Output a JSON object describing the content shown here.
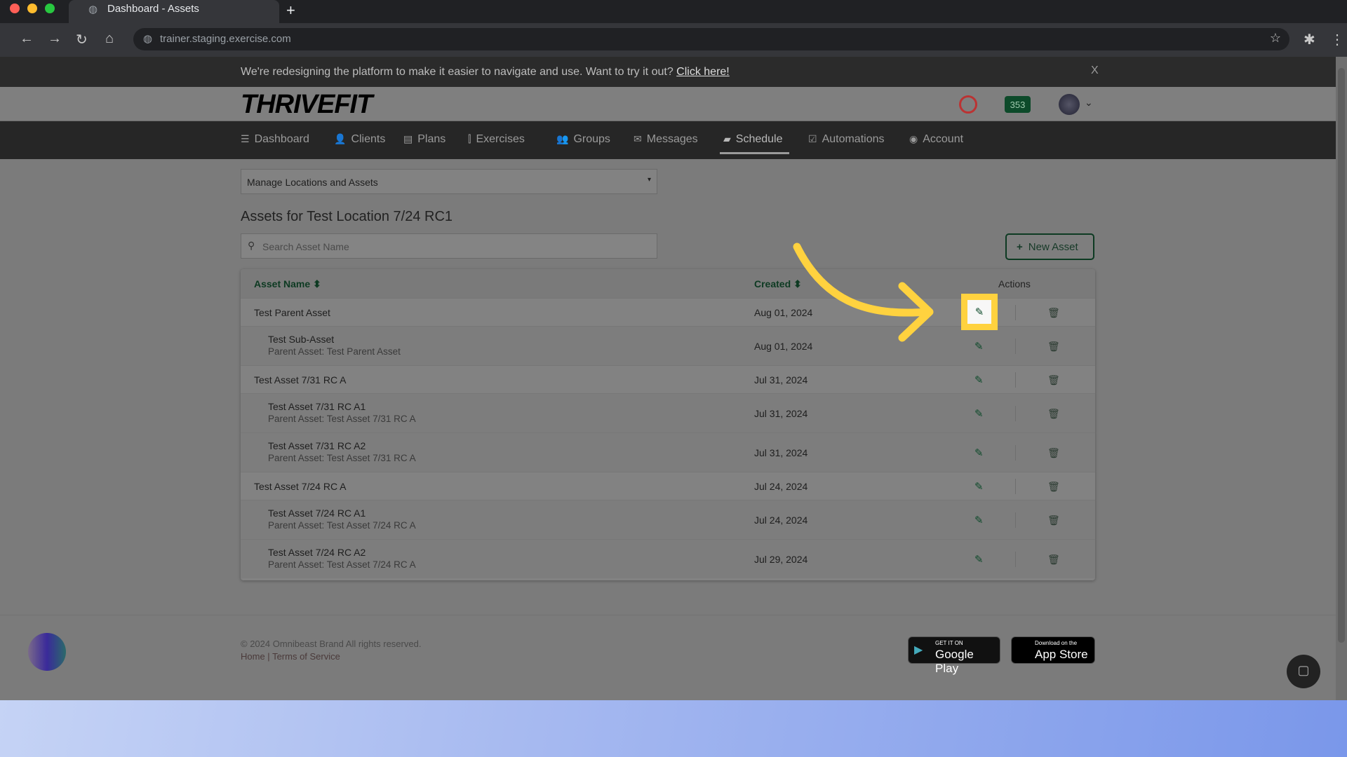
{
  "browser": {
    "tab_title": "Dashboard - Assets",
    "url": "trainer.staging.exercise.com"
  },
  "banner": {
    "text": "We're redesigning the platform to make it easier to navigate and use. Want to try it out?",
    "link": "Click here!",
    "close": "X"
  },
  "header": {
    "logo": "THRIVEFIT",
    "badge_count": "353"
  },
  "nav": [
    {
      "label": "Dashboard",
      "icon": "☰"
    },
    {
      "label": "Clients",
      "icon": "👤"
    },
    {
      "label": "Plans",
      "icon": "▤"
    },
    {
      "label": "Exercises",
      "icon": "⫿"
    },
    {
      "label": "Groups",
      "icon": "👥"
    },
    {
      "label": "Messages",
      "icon": "✉"
    },
    {
      "label": "Schedule",
      "icon": "▰",
      "active": true
    },
    {
      "label": "Automations",
      "icon": "☑"
    },
    {
      "label": "Account",
      "icon": "◉"
    }
  ],
  "main": {
    "select_value": "Manage Locations and Assets",
    "title": "Assets for Test Location 7/24 RC1",
    "search_placeholder": "Search Asset Name",
    "new_asset_label": "New Asset",
    "columns": {
      "name": "Asset Name",
      "created": "Created",
      "actions": "Actions"
    },
    "rows": [
      {
        "name": "Test Parent Asset",
        "parent": "",
        "created": "Aug 01, 2024",
        "highlight": true
      },
      {
        "name": "Test Sub-Asset",
        "parent": "Parent Asset: Test Parent Asset",
        "created": "Aug 01, 2024"
      },
      {
        "name": "Test Asset 7/31 RC A",
        "parent": "",
        "created": "Jul 31, 2024"
      },
      {
        "name": "Test Asset 7/31 RC A1",
        "parent": "Parent Asset: Test Asset 7/31 RC A",
        "created": "Jul 31, 2024"
      },
      {
        "name": "Test Asset 7/31 RC A2",
        "parent": "Parent Asset: Test Asset 7/31 RC A",
        "created": "Jul 31, 2024"
      },
      {
        "name": "Test Asset 7/24 RC A",
        "parent": "",
        "created": "Jul 24, 2024"
      },
      {
        "name": "Test Asset 7/24 RC A1",
        "parent": "Parent Asset: Test Asset 7/24 RC A",
        "created": "Jul 24, 2024"
      },
      {
        "name": "Test Asset 7/24 RC A2",
        "parent": "Parent Asset: Test Asset 7/24 RC A",
        "created": "Jul 29, 2024"
      }
    ]
  },
  "footer": {
    "copyright": "© 2024 Omnibeast Brand All rights reserved.",
    "home": "Home",
    "terms": "Terms of Service",
    "google_small": "GET IT ON",
    "google": "Google Play",
    "apple_small": "Download on the",
    "apple": "App Store"
  },
  "colors": {
    "accent": "#0d4a2a",
    "highlight": "#ffd23f"
  }
}
